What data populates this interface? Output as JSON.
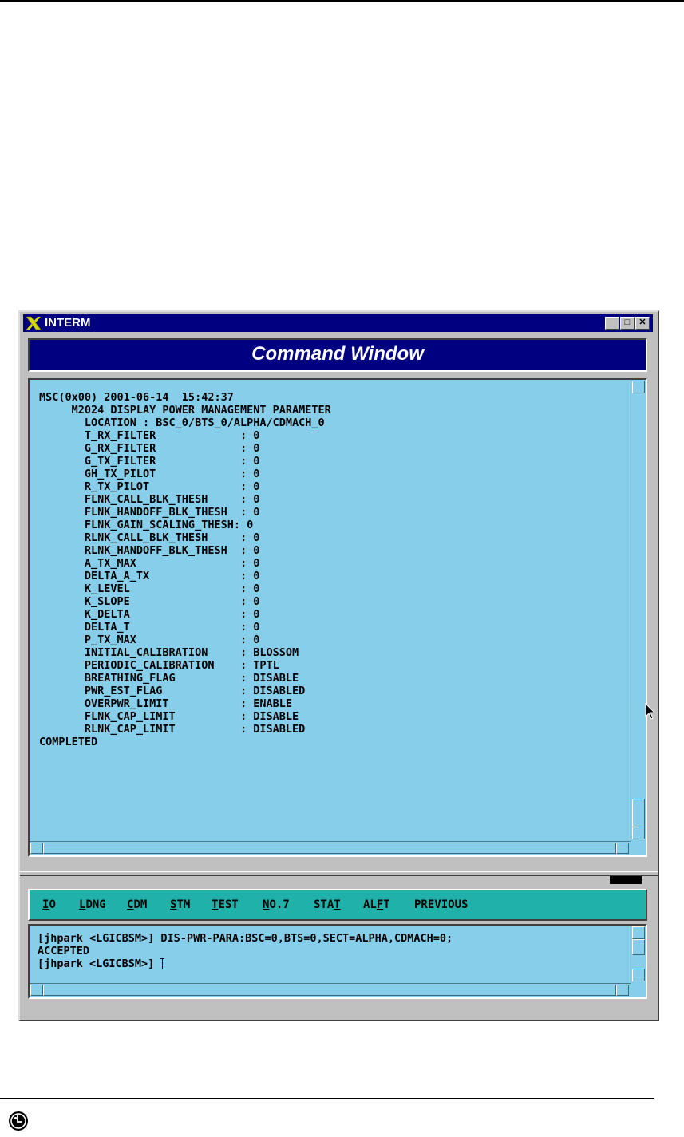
{
  "window": {
    "title": "INTERM",
    "minimize_glyph": "_",
    "maximize_glyph": "□",
    "close_glyph": "✕"
  },
  "command_header": {
    "title": "Command Window"
  },
  "output": {
    "lines": [
      "MSC(0x00) 2001-06-14  15:42:37",
      "     M2024 DISPLAY POWER MANAGEMENT PARAMETER",
      "       LOCATION : BSC_0/BTS_0/ALPHA/CDMACH_0",
      "       T_RX_FILTER             : 0",
      "       G_RX_FILTER             : 0",
      "       G_TX_FILTER             : 0",
      "       GH_TX_PILOT             : 0",
      "       R_TX_PILOT              : 0",
      "       FLNK_CALL_BLK_THESH     : 0",
      "       FLNK_HANDOFF_BLK_THESH  : 0",
      "       FLNK_GAIN_SCALING_THESH: 0",
      "       RLNK_CALL_BLK_THESH     : 0",
      "       RLNK_HANDOFF_BLK_THESH  : 0",
      "       A_TX_MAX                : 0",
      "       DELTA_A_TX              : 0",
      "       K_LEVEL                 : 0",
      "       K_SLOPE                 : 0",
      "       K_DELTA                 : 0",
      "       DELTA_T                 : 0",
      "       P_TX_MAX                : 0",
      "       INITIAL_CALIBRATION     : BLOSSOM",
      "       PERIODIC_CALIBRATION    : TPTL",
      "       BREATHING_FLAG          : DISABLE",
      "       PWR_EST_FLAG            : DISABLED",
      "       OVERPWR_LIMIT           : ENABLE",
      "       FLNK_CAP_LIMIT          : DISABLE",
      "       RLNK_CAP_LIMIT          : DISABLED",
      "COMPLETED"
    ]
  },
  "menu": {
    "items": [
      {
        "prefix": "",
        "key": "I",
        "rest": "O"
      },
      {
        "prefix": "",
        "key": "L",
        "rest": "DNG"
      },
      {
        "prefix": "",
        "key": "C",
        "rest": "DM"
      },
      {
        "prefix": "",
        "key": "S",
        "rest": "TM"
      },
      {
        "prefix": "",
        "key": "T",
        "rest": "EST"
      },
      {
        "prefix": "",
        "key": "N",
        "rest": "O.7"
      },
      {
        "prefix": "STA",
        "key": "T",
        "rest": ""
      },
      {
        "prefix": "AL",
        "key": "F",
        "rest": "T"
      },
      {
        "prefix": "PREVIOUS",
        "key": "",
        "rest": ""
      }
    ]
  },
  "input": {
    "lines": [
      "[jhpark <LGICBSM>] DIS-PWR-PARA:BSC=0,BTS=0,SECT=ALPHA,CDMACH=0;",
      "ACCEPTED",
      "[jhpark <LGICBSM>] "
    ]
  },
  "colors": {
    "title_bar": "#000080",
    "pane_background": "#87ceeb",
    "menu_background": "#20b2aa",
    "window_gray": "#c0c0c0"
  },
  "icons": {
    "app": "x-logo-icon",
    "cursor": "mouse-pointer-icon",
    "footer_logo": "lg-logo-icon"
  }
}
